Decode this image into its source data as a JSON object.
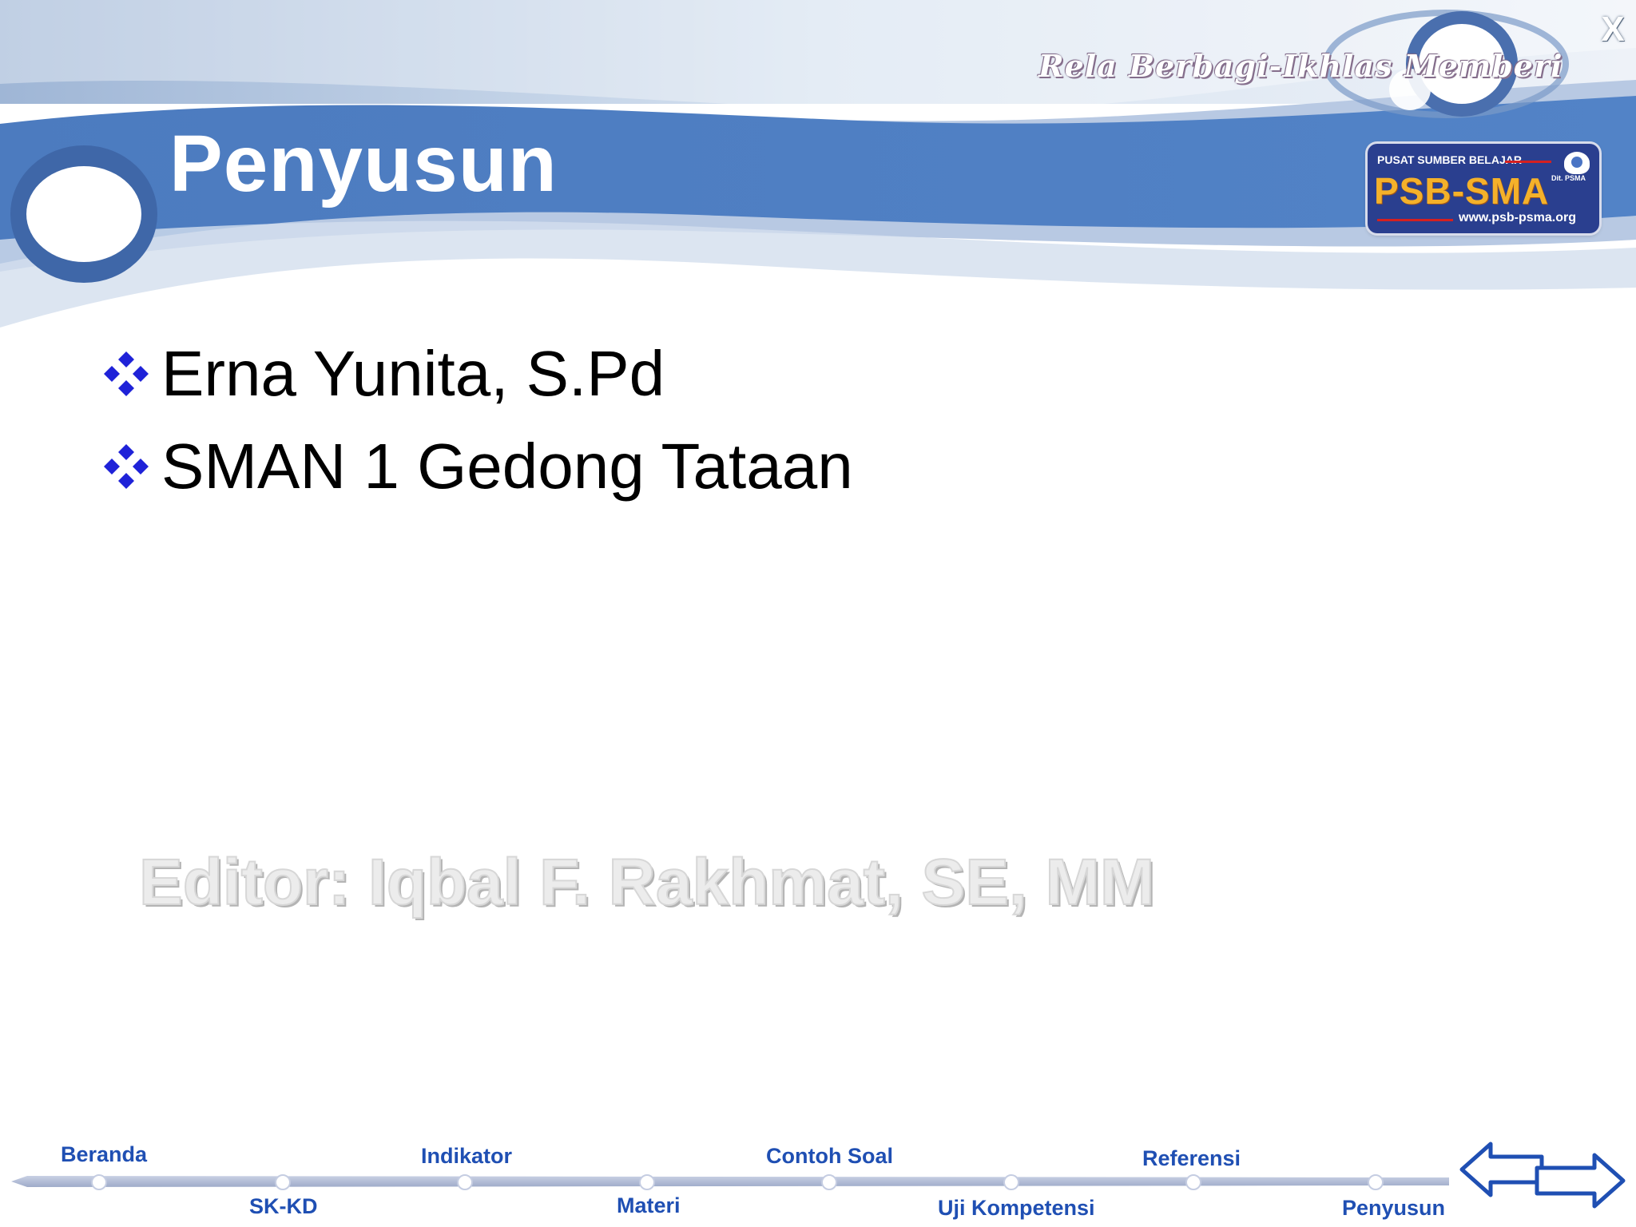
{
  "header": {
    "tagline": "Rela Berbagi-Ikhlas Memberi",
    "title": "Penyusun",
    "close_label": "X"
  },
  "logo": {
    "top_text": "PUSAT SUMBER BELAJAR",
    "main_text": "PSB-SMA",
    "sub_text": "Dit. PSMA",
    "url": "www.psb-psma.org"
  },
  "content": {
    "items": [
      {
        "text": "Erna Yunita, S.Pd"
      },
      {
        "text": "SMAN 1 Gedong Tataan"
      }
    ],
    "editor": "Editor: Iqbal F. Rakhmat, SE, MM"
  },
  "nav": {
    "items": [
      {
        "label": "Beranda"
      },
      {
        "label": "SK-KD"
      },
      {
        "label": "Indikator"
      },
      {
        "label": "Materi"
      },
      {
        "label": "Contoh Soal"
      },
      {
        "label": "Uji Kompetensi"
      },
      {
        "label": "Referensi"
      },
      {
        "label": "Penyusun"
      }
    ]
  },
  "colors": {
    "banner_blue": "#4f7fc2",
    "nav_text": "#1f4fb3",
    "bullet_blue": "#1f22d8"
  }
}
